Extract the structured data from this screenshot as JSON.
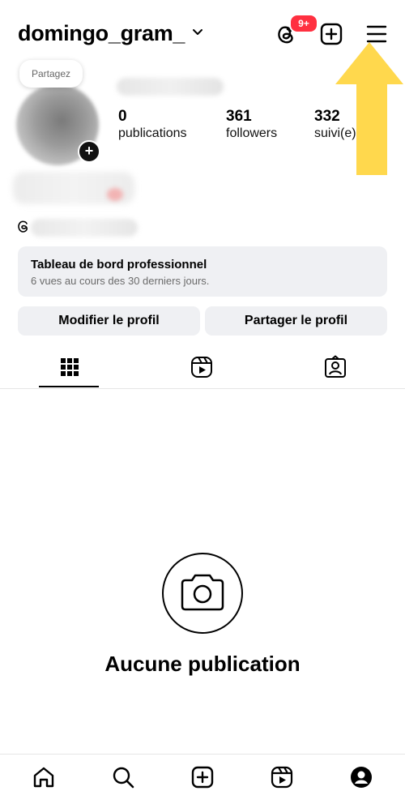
{
  "header": {
    "username": "domingo_gram_",
    "threads_badge": "9+"
  },
  "profile": {
    "note_label": "Partagez",
    "stats": [
      {
        "value": "0",
        "label": "publications"
      },
      {
        "value": "361",
        "label": "followers"
      },
      {
        "value": "332",
        "label": "suivi(e)"
      }
    ]
  },
  "dashboard": {
    "title": "Tableau de bord professionnel",
    "subtitle": "6 vues au cours des 30 derniers jours."
  },
  "buttons": {
    "edit_profile": "Modifier le profil",
    "share_profile": "Partager le profil"
  },
  "tabs": [
    {
      "icon": "grid-icon",
      "active": true
    },
    {
      "icon": "reels-icon",
      "active": false
    },
    {
      "icon": "tagged-icon",
      "active": false
    }
  ],
  "empty_state": {
    "icon": "camera-icon",
    "title": "Aucune publication"
  },
  "bottom_nav": [
    {
      "icon": "home-icon"
    },
    {
      "icon": "search-icon"
    },
    {
      "icon": "create-icon"
    },
    {
      "icon": "reels-icon"
    },
    {
      "icon": "profile-icon"
    }
  ],
  "colors": {
    "badge": "#ff3040",
    "arrow": "#ffd84d",
    "panel": "#eff0f3"
  }
}
